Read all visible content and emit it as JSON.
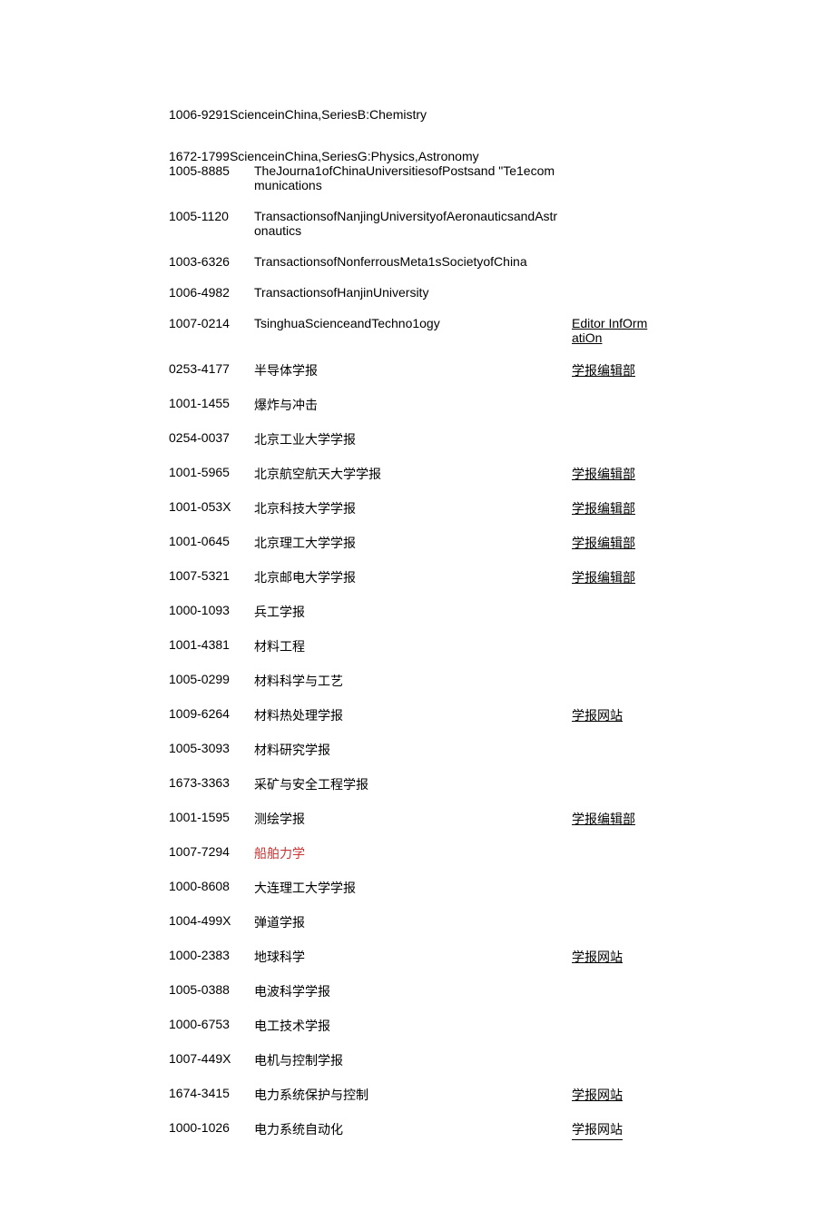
{
  "top_lines": [
    "1006-9291ScienceinChina,SeriesB:Chemistry",
    "1672-1799ScienceinChina,SeriesG:Physics,Astronomy"
  ],
  "rows": [
    {
      "issn": "1005-8885",
      "title": "TheJourna1ofChinaUniversitiesofPostsand \"Te1ecommunications",
      "link": ""
    },
    {
      "issn": "1005-1120",
      "title": "TransactionsofNanjingUniversityofAeronauticsandAstronautics",
      "link": ""
    },
    {
      "issn": "1003-6326",
      "title": "TransactionsofNonferrousMeta1sSocietyofChina",
      "link": ""
    },
    {
      "issn": "1006-4982",
      "title": "TransactionsofHanjinUniversity",
      "link": ""
    },
    {
      "issn": "1007-0214",
      "title": "TsinghuaScienceandTechno1ogy",
      "link": "Editor InfOrmatiOn"
    },
    {
      "issn": "0253-4177",
      "title": "半导体学报",
      "link": "学报编辑部"
    },
    {
      "issn": "1001-1455",
      "title": "爆炸与冲击",
      "link": ""
    },
    {
      "issn": "0254-0037",
      "title": "北京工业大学学报",
      "link": ""
    },
    {
      "issn": "1001-5965",
      "title": "北京航空航天大学学报",
      "link": "学报编辑部"
    },
    {
      "issn": "1001-053X",
      "title": "北京科技大学学报",
      "link": "学报编辑部"
    },
    {
      "issn": "1001-0645",
      "title": "北京理工大学学报",
      "link": "学报编辑部"
    },
    {
      "issn": "1007-5321",
      "title": "北京邮电大学学报",
      "link": "学报编辑部"
    },
    {
      "issn": "1000-1093",
      "title": "兵工学报",
      "link": ""
    },
    {
      "issn": "1001-4381",
      "title": "材料工程",
      "link": ""
    },
    {
      "issn": "1005-0299",
      "title": "材料科学与工艺",
      "link": ""
    },
    {
      "issn": "1009-6264",
      "title": "材料热处理学报",
      "link": "学报网站"
    },
    {
      "issn": "1005-3093",
      "title": "材料研究学报",
      "link": ""
    },
    {
      "issn": "1673-3363",
      "title": "采矿与安全工程学报",
      "link": ""
    },
    {
      "issn": "1001-1595",
      "title": "测绘学报",
      "link": "学报编辑部"
    },
    {
      "issn": "1007-7294",
      "title": "船舶力学",
      "link": "",
      "red": true
    },
    {
      "issn": "1000-8608",
      "title": "大连理工大学学报",
      "link": ""
    },
    {
      "issn": "1004-499X",
      "title": "弹道学报",
      "link": ""
    },
    {
      "issn": "1000-2383",
      "title": "地球科学",
      "link": "学报网站"
    },
    {
      "issn": "1005-0388",
      "title": "电波科学学报",
      "link": ""
    },
    {
      "issn": "1000-6753",
      "title": "电工技术学报",
      "link": ""
    },
    {
      "issn": "1007-449X",
      "title": "电机与控制学报",
      "link": ""
    },
    {
      "issn": "1674-3415",
      "title": "电力系统保护与控制",
      "link": "学报网站"
    },
    {
      "issn": "1000-1026",
      "title": "电力系统自动化",
      "link": "学报网站",
      "last": true
    }
  ]
}
